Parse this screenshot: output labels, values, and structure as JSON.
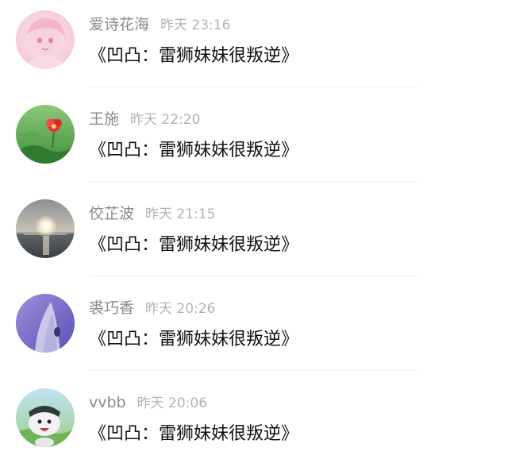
{
  "comments": [
    {
      "user": "爱诗花海",
      "time": "昨天 23:16",
      "text": "《凹凸：雷狮妹妹很叛逆》",
      "avatar_icon": "anime-girl-avatar-icon"
    },
    {
      "user": "王施",
      "time": "昨天 22:20",
      "text": "《凹凸：雷狮妹妹很叛逆》",
      "avatar_icon": "red-flower-avatar-icon"
    },
    {
      "user": "佼芷波",
      "time": "昨天 21:15",
      "text": "《凹凸：雷狮妹妹很叛逆》",
      "avatar_icon": "sunset-sea-avatar-icon"
    },
    {
      "user": "裘巧香",
      "time": "昨天 20:26",
      "text": "《凹凸：雷狮妹妹很叛逆》",
      "avatar_icon": "purple-wave-avatar-icon"
    },
    {
      "user": "vvbb",
      "time": "昨天 20:06",
      "text": "《凹凸：雷狮妹妹很叛逆》",
      "avatar_icon": "cartoon-character-avatar-icon"
    }
  ]
}
